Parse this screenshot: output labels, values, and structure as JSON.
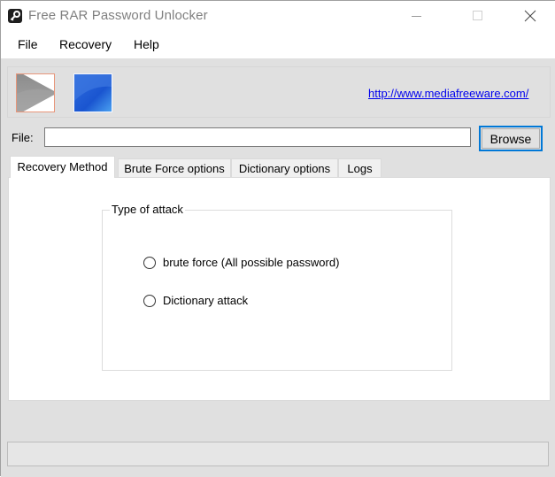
{
  "window": {
    "title": "Free RAR Password Unlocker",
    "app_icon": "key-icon",
    "controls": {
      "minimize_icon": "minimize-icon",
      "maximize_icon": "maximize-icon",
      "close_icon": "close-icon"
    }
  },
  "menubar": {
    "items": [
      {
        "label": "File"
      },
      {
        "label": "Recovery"
      },
      {
        "label": "Help"
      }
    ]
  },
  "toolbar": {
    "start_icon": "play-icon",
    "stop_icon": "stop-icon",
    "link_text": "http://www.mediafreeware.com/"
  },
  "file": {
    "label": "File:",
    "value": "",
    "placeholder": "",
    "browse_label": "Browse"
  },
  "tabs": [
    {
      "label": "Recovery Method",
      "active": true
    },
    {
      "label": "Brute Force options",
      "active": false
    },
    {
      "label": "Dictionary options",
      "active": false
    },
    {
      "label": "Logs",
      "active": false
    }
  ],
  "recovery_method": {
    "group_title": "Type of attack",
    "options": [
      {
        "label": "brute force (All possible password)",
        "checked": false
      },
      {
        "label": "Dictionary attack",
        "checked": false
      }
    ]
  },
  "progress": {
    "percent": 0
  }
}
